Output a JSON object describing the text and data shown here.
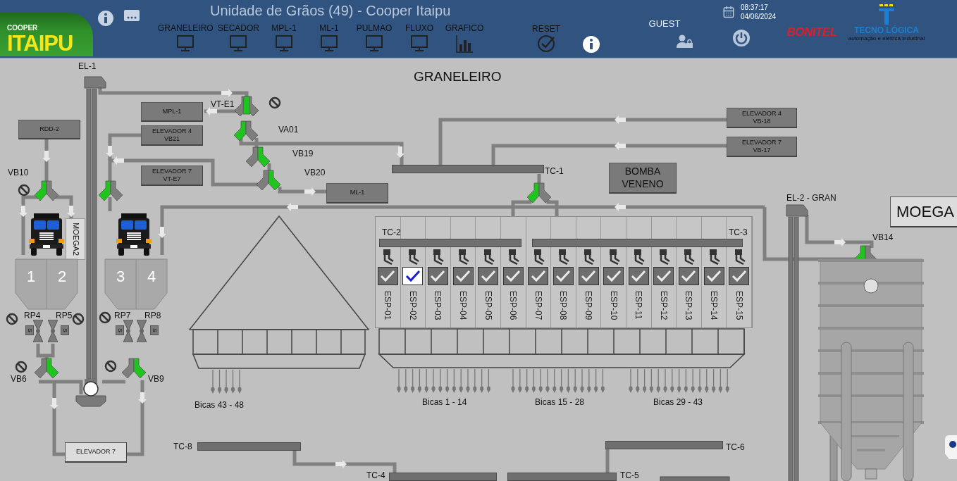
{
  "header": {
    "logo": {
      "line_1": "COOPER",
      "line_2": "ITAIPU"
    },
    "title": "Unidade de Grãos (49) - Cooper Itaipu",
    "nav": [
      {
        "label": "GRANELEIRO",
        "kind": "screen"
      },
      {
        "label": "SECADOR",
        "kind": "screen"
      },
      {
        "label": "MPL-1",
        "kind": "screen"
      },
      {
        "label": "ML-1",
        "kind": "screen"
      },
      {
        "label": "PULMAO",
        "kind": "screen"
      },
      {
        "label": "FLUXO",
        "kind": "screen"
      },
      {
        "label": "GRAFICO",
        "kind": "chart"
      }
    ],
    "reset": {
      "label": "RESET"
    },
    "user": {
      "name": "GUEST"
    },
    "clock": {
      "time": "08:37:17",
      "date": "04/06/2024"
    },
    "brands": [
      {
        "name": "BONITEL"
      },
      {
        "name": "TECNO LÓGICA",
        "tagline": "automação e elétrica industrial"
      }
    ]
  },
  "diagram": {
    "title": "GRANELEIRO",
    "elevators": [
      {
        "label": "EL-1"
      },
      {
        "label": "EL-2 - GRAN"
      }
    ],
    "equipment": [
      {
        "kind": "dark",
        "lines": [
          "RDD-2"
        ]
      },
      {
        "kind": "dark",
        "lines": [
          "MPL-1"
        ]
      },
      {
        "kind": "dark",
        "lines": [
          "ELEVADOR 4",
          "VB21"
        ]
      },
      {
        "kind": "dark",
        "lines": [
          "ELEVADOR 7",
          "VT-E7"
        ]
      },
      {
        "kind": "dark",
        "lines": [
          "ML-1"
        ]
      },
      {
        "kind": "dark",
        "lines": [
          "ELEVADOR 4",
          "VB-18"
        ]
      },
      {
        "kind": "dark",
        "lines": [
          "ELEVADOR 7",
          "VB-17"
        ]
      },
      {
        "kind": "panel",
        "lines": [
          "BOMBA",
          "VENENO"
        ]
      },
      {
        "kind": "light",
        "lines": [
          "ELEVADOR 7"
        ]
      },
      {
        "kind": "sign",
        "lines": [
          "MOEGA"
        ]
      },
      {
        "kind": "vertical",
        "lines": [
          "MOEGA2"
        ]
      }
    ],
    "valves": [
      {
        "label": "VT-E1",
        "left_open": false,
        "center_open": true,
        "right_open": false,
        "blocked": true
      },
      {
        "label": "VA01",
        "left_open": true,
        "center_open": false,
        "right_open": false,
        "blocked": false
      },
      {
        "label": "VB19",
        "left_open": false,
        "center_open": false,
        "right_open": true,
        "blocked": false
      },
      {
        "label": "VB20",
        "left_open": false,
        "center_open": false,
        "right_open": true,
        "blocked": false
      },
      {
        "label": "VB10",
        "left_open": true,
        "center_open": false,
        "right_open": false,
        "blocked": true
      },
      {
        "left_open": true,
        "center_open": false,
        "right_open": false,
        "blocked": false
      },
      {
        "left_open": true,
        "center_open": false,
        "right_open": false,
        "blocked": false
      },
      {
        "label": "VB14",
        "left_open": true,
        "center_open": false,
        "right_open": false,
        "blocked": false
      },
      {
        "label": "VB6",
        "left_open": false,
        "center_open": false,
        "right_open": true,
        "blocked": true
      },
      {
        "label": "VB9",
        "left_open": false,
        "center_open": false,
        "right_open": true,
        "blocked": true
      }
    ],
    "gates": [
      {
        "label": "RP4",
        "tag": "S",
        "blocked": true
      },
      {
        "label": "RP5",
        "tag": "S",
        "blocked": true
      },
      {
        "label": "RP7",
        "tag": "S",
        "blocked": true
      },
      {
        "label": "RP8",
        "tag": "S",
        "blocked": false
      }
    ],
    "bins": [
      {
        "label": "1"
      },
      {
        "label": "2"
      },
      {
        "label": "3"
      },
      {
        "label": "4"
      }
    ],
    "conveyors": [
      {
        "label": "TC-1"
      },
      {
        "label": "TC-2"
      },
      {
        "label": "TC-3"
      },
      {
        "label": "TC-8"
      },
      {
        "label": "TC-6"
      },
      {
        "label": "TC-4"
      },
      {
        "label": "TC-5"
      }
    ],
    "spouts": [
      {
        "label": "ESP-01",
        "checked": true,
        "highlighted": false
      },
      {
        "label": "ESP-02",
        "checked": true,
        "highlighted": true
      },
      {
        "label": "ESP-03",
        "checked": true,
        "highlighted": false
      },
      {
        "label": "ESP-04",
        "checked": true,
        "highlighted": false
      },
      {
        "label": "ESP-05",
        "checked": true,
        "highlighted": false
      },
      {
        "label": "ESP-06",
        "checked": true,
        "highlighted": false
      },
      {
        "label": "ESP-07",
        "checked": true,
        "highlighted": false
      },
      {
        "label": "ESP-08",
        "checked": true,
        "highlighted": false
      },
      {
        "label": "ESP-09",
        "checked": true,
        "highlighted": false
      },
      {
        "label": "ESP-10",
        "checked": true,
        "highlighted": false
      },
      {
        "label": "ESP-11",
        "checked": true,
        "highlighted": false
      },
      {
        "label": "ESP-12",
        "checked": true,
        "highlighted": false
      },
      {
        "label": "ESP-13",
        "checked": true,
        "highlighted": false
      },
      {
        "label": "ESP-14",
        "checked": true,
        "highlighted": false
      },
      {
        "label": "ESP-15",
        "checked": true,
        "highlighted": false
      }
    ],
    "outlets": [
      {
        "label": "Bicas 43 - 48"
      },
      {
        "label": "Bicas 1 - 14"
      },
      {
        "label": "Bicas 15 - 28"
      },
      {
        "label": "Bicas 29 - 43"
      }
    ]
  }
}
